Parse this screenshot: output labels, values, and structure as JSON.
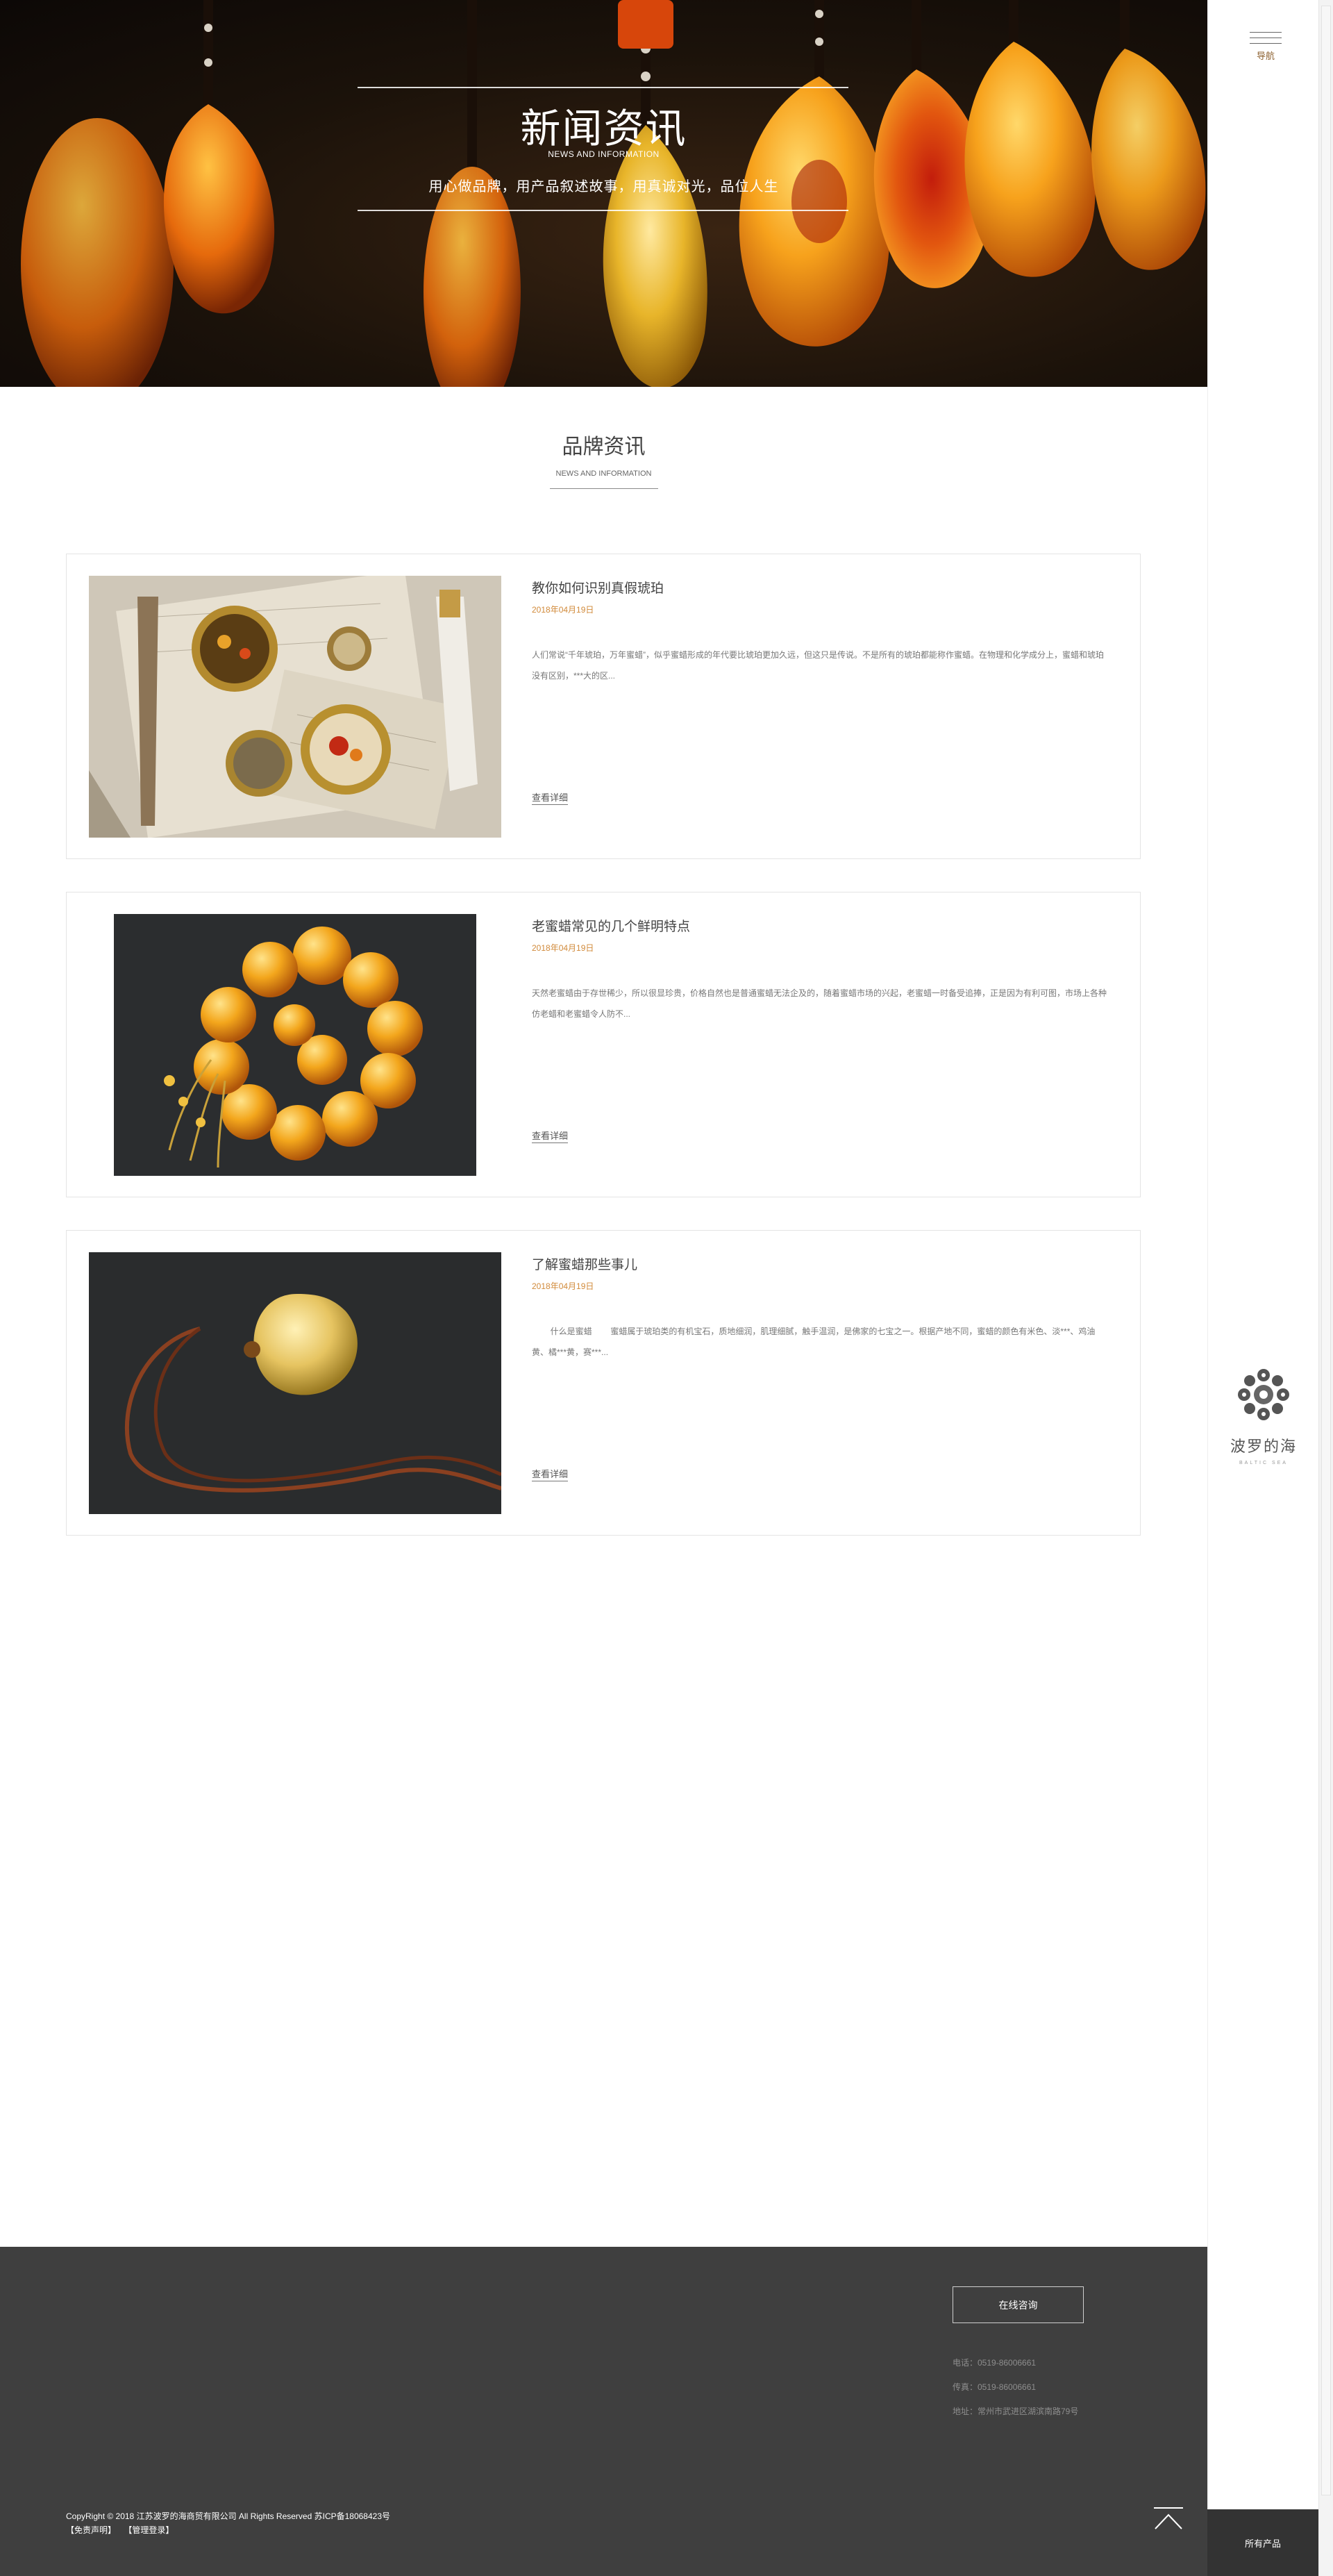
{
  "hero": {
    "title": "新闻资讯",
    "subtitle": "NEWS AND INFORMATION",
    "slogan": "用心做品牌，用产品叙述故事，用真诚对光，品位人生"
  },
  "sidebar": {
    "menu_label": "导航",
    "brand_name": "波罗的海",
    "brand_en": "BALTIC SEA",
    "all_products": "所有产品"
  },
  "section": {
    "title": "品牌资讯",
    "subtitle": "NEWS AND INFORMATION"
  },
  "news": [
    {
      "title": "教你如何识别真假琥珀",
      "date": "2018年04月19日",
      "excerpt": "人们常说“千年琥珀，万年蜜蜡”，似乎蜜蜡形成的年代要比琥珀更加久远，但这只是传说。不是所有的琥珀都能称作蜜蜡。在物理和化学成分上，蜜蜡和琥珀没有区别，***大的区...",
      "more": "查看详细"
    },
    {
      "title": "老蜜蜡常见的几个鲜明特点",
      "date": "2018年04月19日",
      "excerpt": "天然老蜜蜡由于存世稀少，所以很显珍贵，价格自然也是普通蜜蜡无法企及的，随着蜜蜡市场的兴起，老蜜蜡一时备受追捧，正是因为有利可图，市场上各种仿老蜡和老蜜蜡令人防不...",
      "more": "查看详细"
    },
    {
      "title": "了解蜜蜡那些事儿",
      "date": "2018年04月19日",
      "excerpt": "        什么是蜜蜡        蜜蜡属于琥珀类的有机宝石，质地细润，肌理细腻，触手温润，是佛家的七宝之一。根据产地不同，蜜蜡的颜色有米色、淡***、鸡油黄、橘***黄，赛***...",
      "more": "查看详细"
    }
  ],
  "footer": {
    "consult": "在线咨询",
    "phone": "电话：0519-86006661",
    "fax": "传真：0519-86006661",
    "address": "地址：常州市武进区湖滨南路79号",
    "copyright": "CopyRight © 2018 江苏波罗的海商贸有限公司 All Rights Reserved 苏ICP备18068423号",
    "links": [
      "【免责声明】",
      "【管理登录】"
    ]
  },
  "colors": {
    "accent": "#d18a3a",
    "footer_bg": "#3f3f3f",
    "dark_button": "#333333"
  }
}
